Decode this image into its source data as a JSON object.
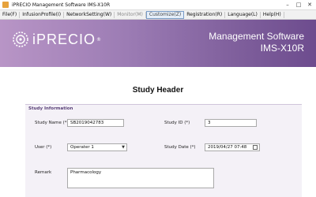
{
  "window": {
    "title": "iPRECIO Management Software IMS-X10R",
    "controls": {
      "minimize": "–",
      "maximize": "□",
      "close": "✕"
    }
  },
  "menu": [
    {
      "label": "File(F)",
      "state": "normal"
    },
    {
      "label": "InfusionProfile(I)",
      "state": "normal"
    },
    {
      "label": "NetworkSetting(W)",
      "state": "normal"
    },
    {
      "label": "Monitor(M)",
      "state": "disabled"
    },
    {
      "label": "Customize(Z)",
      "state": "selected"
    },
    {
      "label": "Registration(R)",
      "state": "normal"
    },
    {
      "label": "Language(L)",
      "state": "normal"
    },
    {
      "label": "Help(H)",
      "state": "normal"
    }
  ],
  "banner": {
    "logo_text": "iPRECIO",
    "logo_reg": "®",
    "title_line1": "Management Software",
    "title_line2": "IMS-X10R"
  },
  "page": {
    "title": "Study Header"
  },
  "section": {
    "header": "Study Information",
    "study_name": {
      "label": "Study Name (*)",
      "value": "SB2019042783"
    },
    "study_id": {
      "label": "Study ID (*)",
      "value": "3"
    },
    "user": {
      "label": "User (*)",
      "value": "Operater 1"
    },
    "study_date": {
      "label": "Study Date (*)",
      "value": "2019/04/27 07:48"
    },
    "remark": {
      "label": "Remark",
      "value": "Pharmacology"
    }
  },
  "icons": {
    "app": "app-icon",
    "dropdown": "chevron-down-icon",
    "calendar": "calendar-icon"
  },
  "colors": {
    "banner_start": "#b895c6",
    "banner_end": "#6d4c8e",
    "section_bg": "#f4f1f7",
    "section_header": "#5a4178"
  }
}
